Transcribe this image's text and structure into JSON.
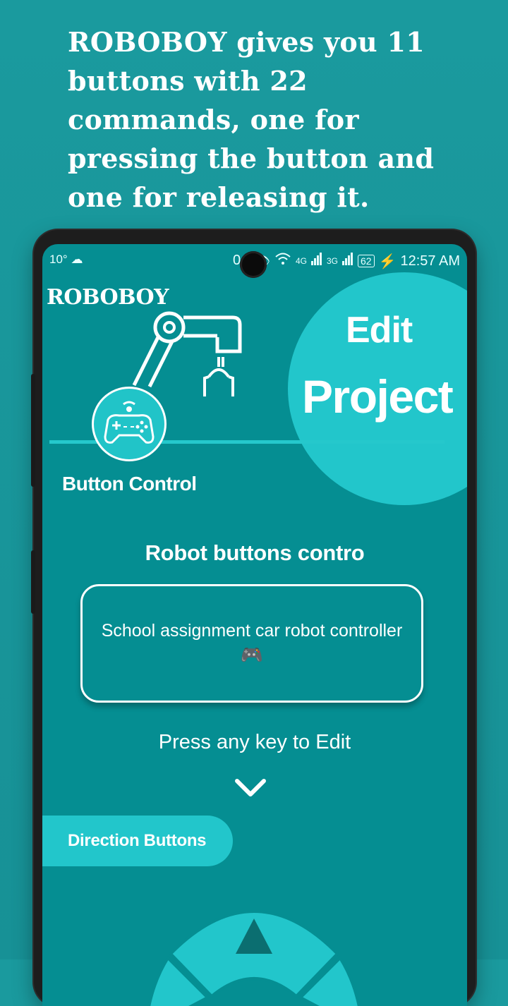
{
  "promo": {
    "headline": "ROBOBOY gives you 11 buttons with 22 commands, one for pressing the button and one for releasing it."
  },
  "statusbar": {
    "left_text": "10°",
    "zero": "0",
    "net1": "4G",
    "net2": "3G",
    "battery": "62",
    "time": "12:57 AM"
  },
  "header": {
    "brand": "ROBOBOY",
    "edit": "Edit",
    "project": "Project",
    "subtitle": "Button Control"
  },
  "main": {
    "section_title": "Robot buttons contro",
    "description": "School assignment car robot controller",
    "description_emoji": "🎮",
    "hint": "Press any key to Edit",
    "category_pill": "Direction Buttons"
  },
  "icons": {
    "weather": "cloud-icon",
    "eye": "eye-comfort-icon",
    "wifi": "wifi-icon",
    "signal": "signal-icon",
    "chevron": "chevron-down-icon",
    "gamepad": "gamepad-icon",
    "robot_arm": "robot-arm-icon",
    "up_arrow": "arrow-up-icon"
  },
  "colors": {
    "background": "#1a9a9e",
    "screen": "#058e92",
    "accent": "#22c6cb",
    "text": "#ffffff"
  }
}
